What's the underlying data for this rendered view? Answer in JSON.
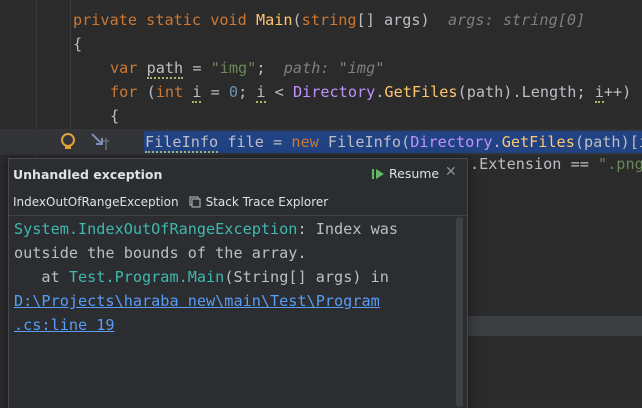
{
  "code": {
    "line1": {
      "kw_private": "private",
      "kw_static": "static",
      "kw_void": "void",
      "method": "Main",
      "paren_open": "(",
      "type_string": "string",
      "brackets": "[] args)",
      "hint": "args: string[0]"
    },
    "line2": {
      "brace": "{"
    },
    "line3": {
      "kw_var": "var",
      "var_name": "path",
      "assign": " = ",
      "str": "\"img\"",
      "semi": ";",
      "hint": "path: \"img\""
    },
    "line4": {
      "kw_for": "for",
      "open": " (",
      "kw_int": "int",
      "var_i": "i",
      "init": " = ",
      "zero": "0",
      "semi1": "; ",
      "var_i2": "i",
      "lt": " < ",
      "cls": "Directory",
      "dot1": ".",
      "method": "GetFiles",
      "args": "(path).Length; ",
      "var_i3": "i",
      "rest": "++)"
    },
    "line5": {
      "brace": "{"
    },
    "line6": {
      "type": "FileInfo",
      "var_file": "file",
      "eq": " = ",
      "kw_new": "new",
      "ctor": "FileInfo",
      "paren": "(",
      "cls": "Directory",
      "dot": ".",
      "method": "GetFiles",
      "args": "(path)[i"
    },
    "line7": {
      "ext": ".Extension == ",
      "str": "\".png"
    }
  },
  "popup": {
    "title": "Unhandled exception",
    "resume_label": "Resume",
    "tab_exception": "IndexOutOfRangeException",
    "tab_stack": "Stack Trace Explorer",
    "message": {
      "exception_type": "System.IndexOutOfRangeException",
      "text1": ": Index was",
      "text2": "outside the bounds of the array.",
      "at": "   at ",
      "frame": "Test.Program.Main",
      "frame_args": "(String[] args) in",
      "path1": "D:\\Projects\\haraba new\\main\\Test\\Program",
      "path2": ".cs:line 19"
    }
  },
  "colors": {
    "editor_bg": "#2b2b2b",
    "selection": "#214283",
    "keyword": "#cc7832",
    "string": "#6a8759",
    "method": "#ffc66d",
    "exception": "#3fb8af",
    "link": "#589df6"
  },
  "icons": {
    "gutter_bulb": "lightbulb-icon",
    "gutter_pointer": "execution-pointer-icon",
    "resume": "resume-icon",
    "close": "close-icon",
    "stack": "stack-trace-icon"
  }
}
